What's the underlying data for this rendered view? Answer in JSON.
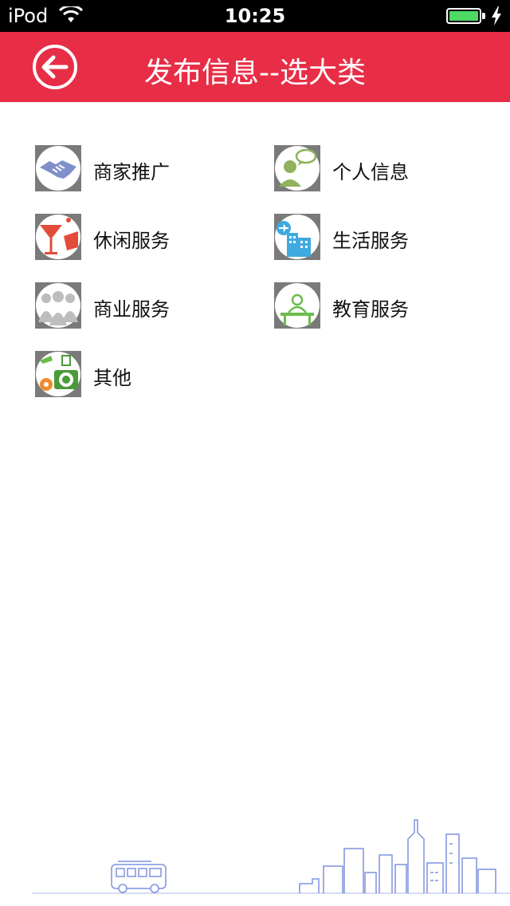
{
  "status_bar": {
    "carrier": "iPod",
    "time": "10:25"
  },
  "header": {
    "title": "发布信息--选大类",
    "back_icon": "back-arrow-icon"
  },
  "categories": [
    {
      "label": "商家推广",
      "icon": "handshake-icon",
      "color": "#7f8fc9"
    },
    {
      "label": "个人信息",
      "icon": "person-chat-icon",
      "color": "#8fb25a"
    },
    {
      "label": "休闲服务",
      "icon": "cocktail-icon",
      "color": "#e34b3b"
    },
    {
      "label": "生活服务",
      "icon": "city-plane-icon",
      "color": "#3fa9e0"
    },
    {
      "label": "商业服务",
      "icon": "people-group-icon",
      "color": "#bdbdbd"
    },
    {
      "label": "教育服务",
      "icon": "teacher-desk-icon",
      "color": "#6cbc4b"
    },
    {
      "label": "其他",
      "icon": "camera-misc-icon",
      "color": "#f08a2a"
    }
  ],
  "colors": {
    "header_bg": "#e82e47",
    "battery": "#4cd964",
    "skyline": "#7f92e0"
  }
}
